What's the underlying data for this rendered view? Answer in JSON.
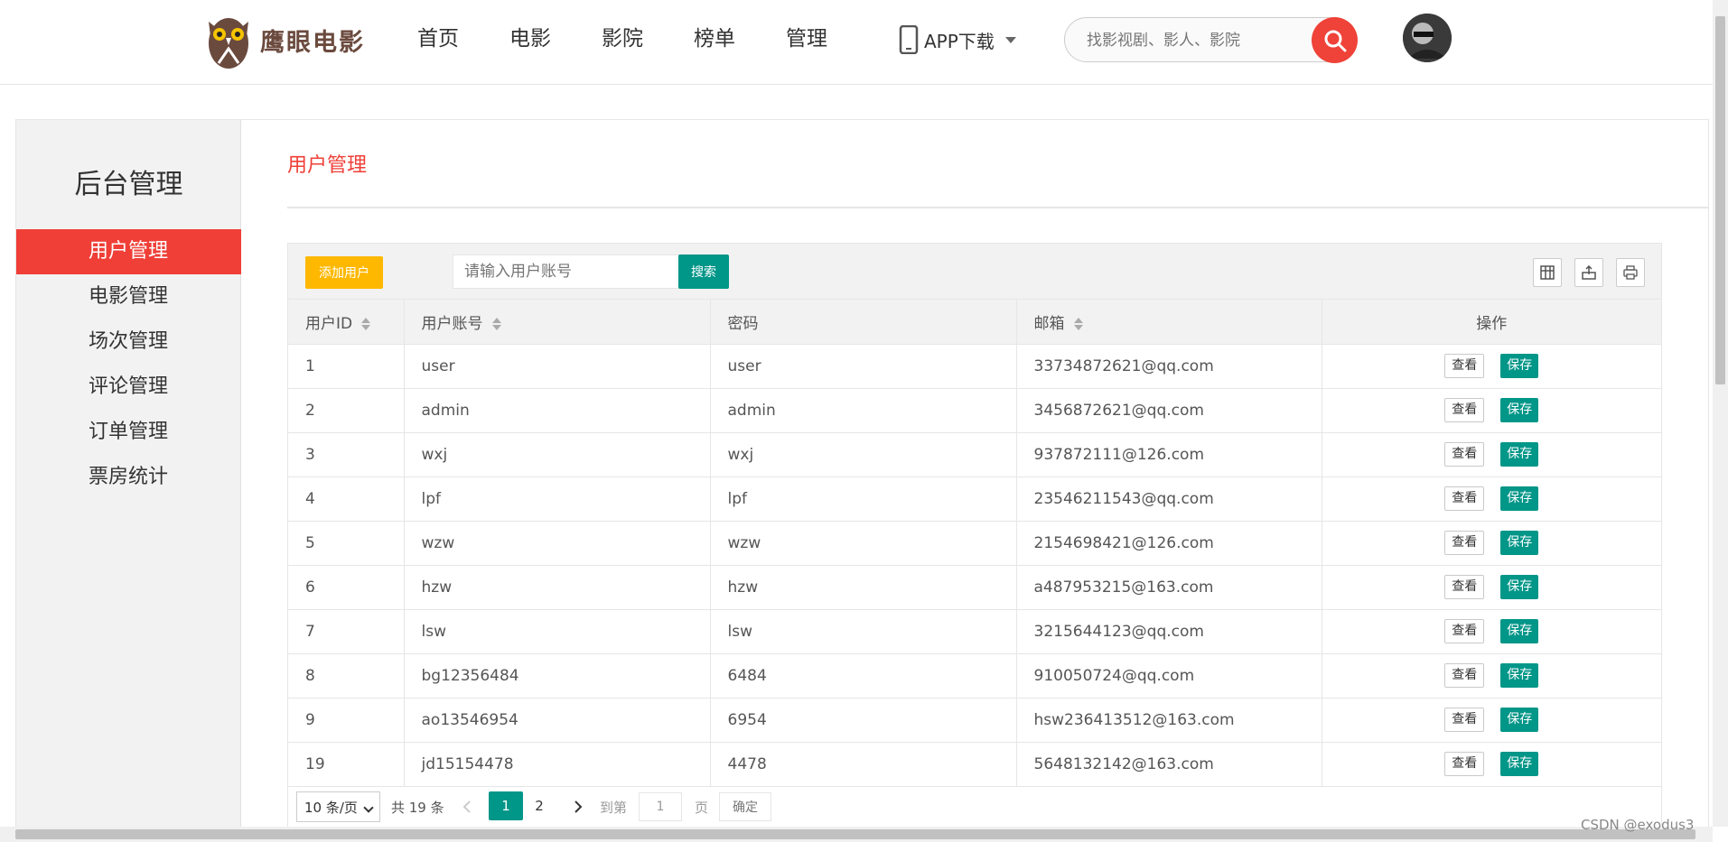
{
  "header": {
    "logo_text": "鹰眼电影",
    "nav": [
      "首页",
      "电影",
      "影院",
      "榜单",
      "管理"
    ],
    "app_download": "APP下载",
    "search_placeholder": "找影视剧、影人、影院"
  },
  "sidebar": {
    "title": "后台管理",
    "items": [
      "用户管理",
      "电影管理",
      "场次管理",
      "评论管理",
      "订单管理",
      "票房统计"
    ],
    "active_index": 0
  },
  "main": {
    "title": "用户管理",
    "add_button": "添加用户",
    "query_placeholder": "请输入用户账号",
    "search_button": "搜索",
    "columns": [
      "用户ID",
      "用户账号",
      "密码",
      "邮箱",
      "操作"
    ],
    "view_label": "查看",
    "save_label": "保存",
    "rows": [
      [
        "1",
        "user",
        "user",
        "33734872621@qq.com"
      ],
      [
        "2",
        "admin",
        "admin",
        "3456872621@qq.com"
      ],
      [
        "3",
        "wxj",
        "wxj",
        "937872111@126.com"
      ],
      [
        "4",
        "lpf",
        "lpf",
        "23546211543@qq.com"
      ],
      [
        "5",
        "wzw",
        "wzw",
        "2154698421@126.com"
      ],
      [
        "6",
        "hzw",
        "hzw",
        "a487953215@163.com"
      ],
      [
        "7",
        "lsw",
        "lsw",
        "3215644123@qq.com"
      ],
      [
        "8",
        "bg12356484",
        "6484",
        "910050724@qq.com"
      ],
      [
        "9",
        "ao13546954",
        "6954",
        "hsw236413512@163.com"
      ],
      [
        "19",
        "jd15154478",
        "4478",
        "5648132142@163.com"
      ]
    ]
  },
  "pagination": {
    "page_size": "10 条/页",
    "total": "共 19 条",
    "pages": [
      "1",
      "2"
    ],
    "current": "1",
    "goto_label": "到第",
    "goto_value": "1",
    "page_suffix": "页",
    "confirm": "确定"
  },
  "watermark": "CSDN @exodus3",
  "colors": {
    "brand_red": "#ef3f37",
    "primary_green": "#009688",
    "warn_yellow": "#ffb800"
  }
}
